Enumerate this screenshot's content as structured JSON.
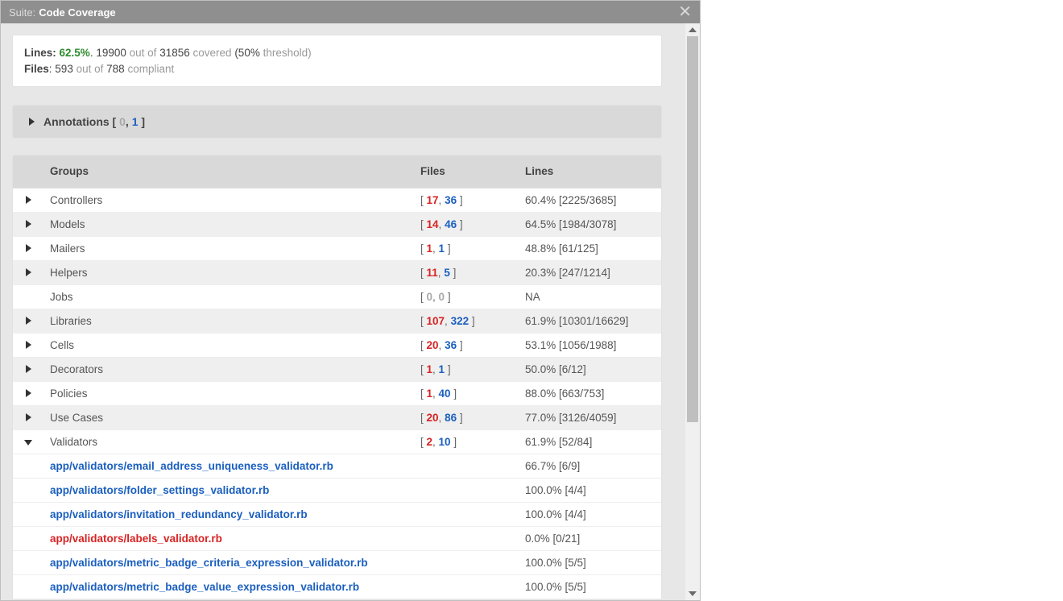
{
  "title": {
    "prefix": "Suite:",
    "name": "Code Coverage"
  },
  "summary": {
    "lines_label": "Lines",
    "lines_pct": "62.5%",
    "lines_covered": "19900",
    "lines_out_of": "out of",
    "lines_total": "31856",
    "lines_covered_word": "covered",
    "threshold_open": "(50%",
    "threshold_word": "threshold)",
    "files_label": "Files",
    "files_count": "593",
    "files_out_of": "out of",
    "files_total": "788",
    "files_compliant": "compliant"
  },
  "annotations": {
    "label": "Annotations",
    "bracket_open": "[",
    "n_gray": "0",
    "comma": ",",
    "n_blue": "1",
    "bracket_close": "]"
  },
  "groups_header": {
    "groups": "Groups",
    "files": "Files",
    "lines": "Lines"
  },
  "groups": [
    {
      "expand": "right",
      "alt": false,
      "name": "Controllers",
      "red": "17",
      "blue": "36",
      "lines": "60.4% [2225/3685]"
    },
    {
      "expand": "right",
      "alt": true,
      "name": "Models",
      "red": "14",
      "blue": "46",
      "lines": "64.5% [1984/3078]"
    },
    {
      "expand": "right",
      "alt": false,
      "name": "Mailers",
      "red": "1",
      "blue": "1",
      "lines": "48.8% [61/125]"
    },
    {
      "expand": "right",
      "alt": true,
      "name": "Helpers",
      "red": "11",
      "blue": "5",
      "lines": "20.3% [247/1214]"
    },
    {
      "expand": "none",
      "alt": false,
      "name": "Jobs",
      "red": "0",
      "blue": "0",
      "gray_files": true,
      "lines": "NA"
    },
    {
      "expand": "right",
      "alt": true,
      "name": "Libraries",
      "red": "107",
      "blue": "322",
      "lines": "61.9% [10301/16629]"
    },
    {
      "expand": "right",
      "alt": false,
      "name": "Cells",
      "red": "20",
      "blue": "36",
      "lines": "53.1% [1056/1988]"
    },
    {
      "expand": "right",
      "alt": true,
      "name": "Decorators",
      "red": "1",
      "blue": "1",
      "lines": "50.0% [6/12]"
    },
    {
      "expand": "right",
      "alt": false,
      "name": "Policies",
      "red": "1",
      "blue": "40",
      "lines": "88.0% [663/753]"
    },
    {
      "expand": "right",
      "alt": true,
      "name": "Use Cases",
      "red": "20",
      "blue": "86",
      "lines": "77.0% [3126/4059]"
    },
    {
      "expand": "down",
      "alt": false,
      "name": "Validators",
      "red": "2",
      "blue": "10",
      "lines": "61.9% [52/84]"
    }
  ],
  "validator_files": [
    {
      "path": "app/validators/email_address_uniqueness_validator.rb",
      "red": false,
      "lines": "66.7% [6/9]"
    },
    {
      "path": "app/validators/folder_settings_validator.rb",
      "red": false,
      "lines": "100.0% [4/4]"
    },
    {
      "path": "app/validators/invitation_redundancy_validator.rb",
      "red": false,
      "lines": "100.0% [4/4]"
    },
    {
      "path": "app/validators/labels_validator.rb",
      "red": true,
      "lines": "0.0% [0/21]"
    },
    {
      "path": "app/validators/metric_badge_criteria_expression_validator.rb",
      "red": false,
      "lines": "100.0% [5/5]"
    },
    {
      "path": "app/validators/metric_badge_value_expression_validator.rb",
      "red": false,
      "lines": "100.0% [5/5]"
    }
  ]
}
